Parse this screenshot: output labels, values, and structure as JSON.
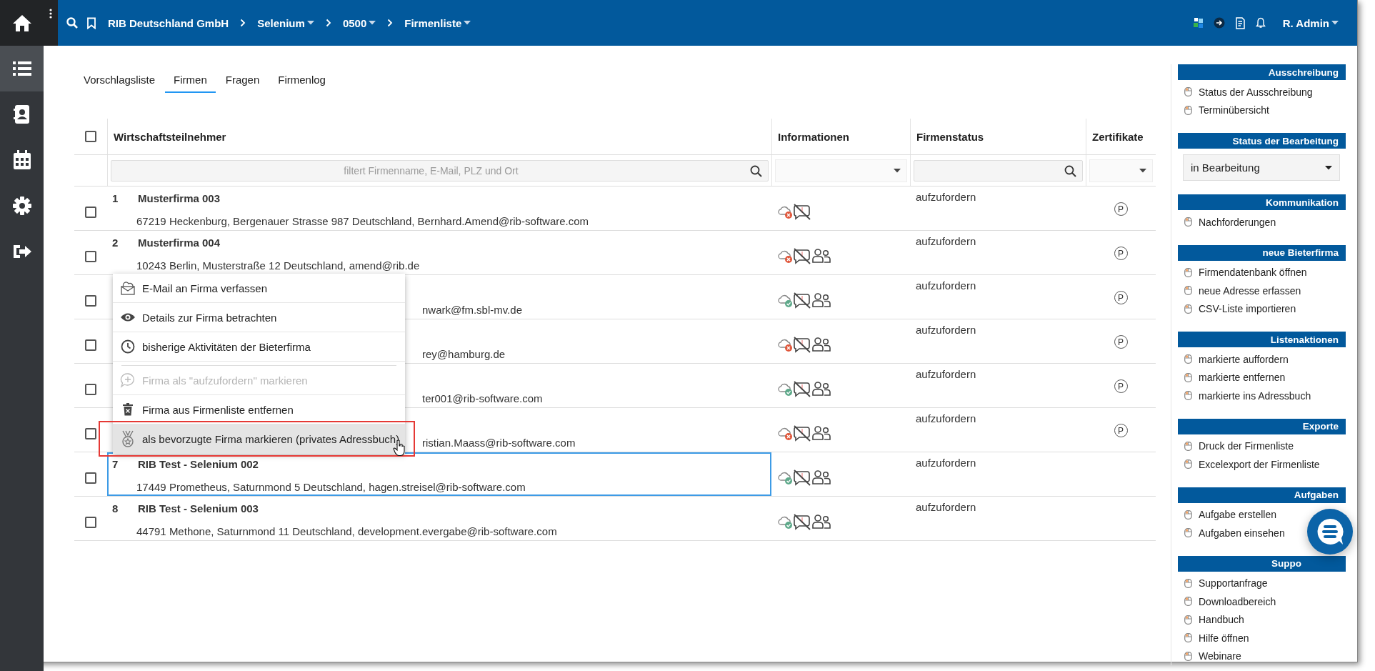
{
  "nav": [
    {
      "kind": "home",
      "selected": false
    },
    {
      "kind": "list",
      "selected": true
    },
    {
      "kind": "contacts",
      "selected": false
    },
    {
      "kind": "calendar",
      "selected": false
    },
    {
      "kind": "settings",
      "selected": false
    },
    {
      "kind": "logout",
      "selected": false
    }
  ],
  "topbar": {
    "breadcrumb": [
      {
        "label": "RIB Deutschland GmbH",
        "dropdown": false
      },
      {
        "label": "Selenium",
        "dropdown": true
      },
      {
        "label": "0500",
        "dropdown": true
      },
      {
        "label": "Firmenliste",
        "dropdown": true
      }
    ],
    "user": "R. Admin"
  },
  "tabs": [
    {
      "label": "Vorschlagsliste",
      "selected": false
    },
    {
      "label": "Firmen",
      "selected": true
    },
    {
      "label": "Fragen",
      "selected": false
    },
    {
      "label": "Firmenlog",
      "selected": false
    }
  ],
  "table": {
    "select_all": {
      "checked": false
    },
    "columns": [
      "Wirtschaftsteilnehmer",
      "Informationen",
      "Firmenstatus",
      "Zertifikate"
    ],
    "filters": [
      {
        "kind": "search",
        "placeholder": "filtert Firmenname, E-Mail, PLZ und Ort"
      },
      {
        "kind": "select"
      },
      {
        "kind": "search"
      },
      {
        "kind": "select"
      }
    ],
    "rows": [
      {
        "kind": "full",
        "number": "1",
        "name": "Musterfirma 003",
        "address": "67219 Heckenburg, Bergenauer Strasse 987 Deutschland, Bernhard.Amend@rib-software.com",
        "checked": false,
        "selected": false,
        "cloud_ok": false,
        "contacts": false,
        "status": "aufzufordern",
        "certificate": "P"
      },
      {
        "kind": "full",
        "number": "2",
        "name": "Musterfirma 004",
        "address": "10243 Berlin, Musterstraße 12 Deutschland, amend@rib.de",
        "checked": false,
        "selected": false,
        "cloud_ok": false,
        "contacts": true,
        "status": "aufzufordern",
        "certificate": "P"
      },
      {
        "kind": "covered",
        "address": "nwark@fm.sbl-mv.de",
        "checked": false,
        "selected": false,
        "cloud_ok": true,
        "contacts": true,
        "status": "aufzufordern",
        "certificate": "P"
      },
      {
        "kind": "covered",
        "address": "rey@hamburg.de",
        "checked": false,
        "selected": false,
        "cloud_ok": false,
        "contacts": true,
        "status": "aufzufordern",
        "certificate": "P"
      },
      {
        "kind": "covered",
        "address": "ter001@rib-software.com",
        "checked": false,
        "selected": false,
        "cloud_ok": true,
        "contacts": true,
        "status": "aufzufordern",
        "certificate": "P"
      },
      {
        "kind": "covered",
        "address": "ristian.Maass@rib-software.com",
        "checked": false,
        "selected": false,
        "cloud_ok": false,
        "contacts": true,
        "status": "aufzufordern",
        "certificate": "P"
      },
      {
        "kind": "full",
        "number": "7",
        "name": "RIB Test - Selenium 002",
        "address": "17449 Prometheus, Saturnmond 5 Deutschland, hagen.streisel@rib-software.com",
        "checked": false,
        "selected": true,
        "cloud_ok": true,
        "contacts": true,
        "status": "aufzufordern"
      },
      {
        "kind": "full",
        "number": "8",
        "name": "RIB Test - Selenium 003",
        "address": "44791 Methone, Saturnmond 11 Deutschland, development.evergabe@rib-software.com",
        "checked": false,
        "selected": false,
        "cloud_ok": true,
        "contacts": true,
        "status": "aufzufordern"
      }
    ]
  },
  "context_menu": {
    "items": [
      {
        "kind": "mail",
        "label": "E-Mail an Firma verfassen",
        "disabled": false,
        "hovered": false,
        "separator": false
      },
      {
        "kind": "view",
        "label": "Details zur Firma betrachten",
        "disabled": false,
        "hovered": false,
        "separator": false
      },
      {
        "kind": "history",
        "label": "bisherige Aktivitäten der Bieterfirma",
        "disabled": false,
        "hovered": false,
        "separator": false
      },
      {
        "kind": "request",
        "label": "Firma als \"aufzufordern\" markieren",
        "disabled": true,
        "hovered": false,
        "separator": true
      },
      {
        "kind": "remove",
        "label": "Firma aus Firmenliste entfernen",
        "disabled": false,
        "hovered": false,
        "separator": false
      },
      {
        "kind": "prefer",
        "label": "als bevorzugte Firma markieren (privates Adressbuch)",
        "disabled": false,
        "hovered": true,
        "separator": false
      }
    ]
  },
  "sidebar": {
    "sections": [
      {
        "title": "Ausschreibung",
        "covered": false,
        "items": [
          "Status der Ausschreibung",
          "Terminübersicht"
        ]
      },
      {
        "title": "Status der Bearbeitung",
        "covered": false,
        "select": "in Bearbeitung"
      },
      {
        "title": "Kommunikation",
        "covered": false,
        "items": [
          "Nachforderungen"
        ]
      },
      {
        "title": "neue Bieterfirma",
        "covered": false,
        "items": [
          "Firmendatenbank öffnen",
          "neue Adresse erfassen",
          "CSV-Liste importieren"
        ]
      },
      {
        "title": "Listenaktionen",
        "covered": false,
        "items": [
          "markierte auffordern",
          "markierte entfernen",
          "markierte ins Adressbuch"
        ]
      },
      {
        "title": "Exporte",
        "covered": false,
        "items": [
          "Druck der Firmenliste",
          "Excelexport der Firmenliste"
        ]
      },
      {
        "title": "Aufgaben",
        "covered": false,
        "items": [
          "Aufgabe erstellen",
          "Aufgaben einsehen"
        ]
      },
      {
        "title": "Suppo",
        "covered": true,
        "items": [
          "Supportanfrage",
          "Downloadbereich",
          "Handbuch",
          "Hilfe öffnen",
          "Webinare"
        ]
      }
    ]
  }
}
